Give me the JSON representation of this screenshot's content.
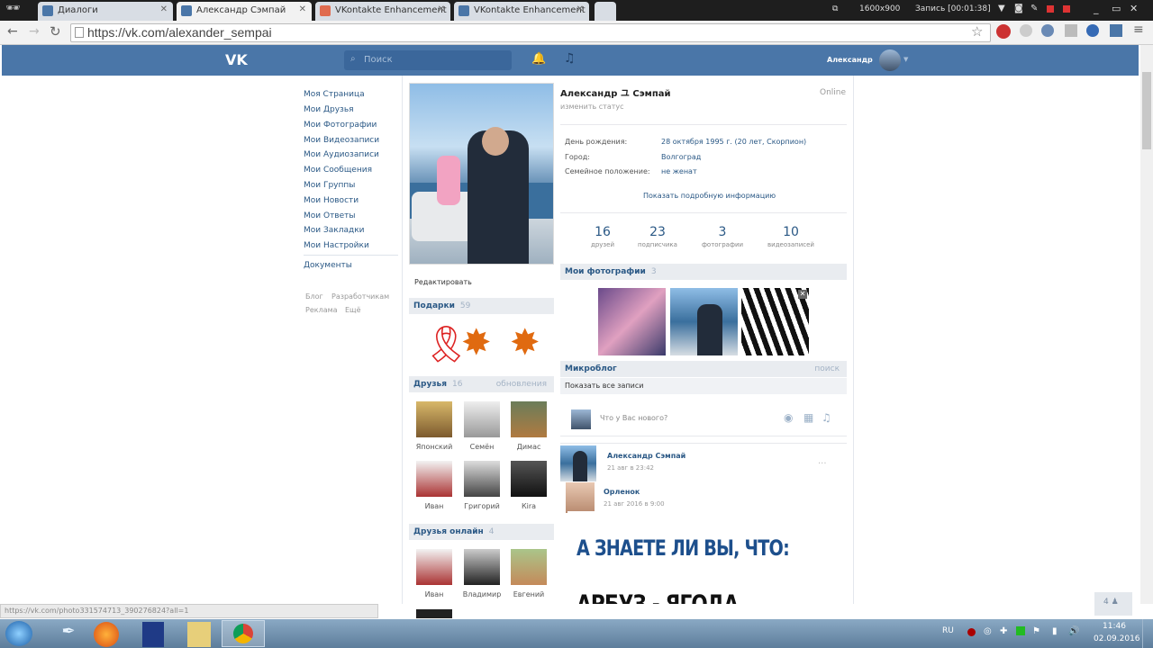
{
  "browser": {
    "tabs": [
      {
        "title": "Диалоги"
      },
      {
        "title": "Александр Сэмпай"
      },
      {
        "title": "VKontakte Enhancement"
      },
      {
        "title": "VKontakte Enhancement"
      }
    ],
    "url": "https://vk.com/alexander_sempai",
    "screen_res": "1600x900",
    "recording": "Запись [00:01:38]",
    "status_url": "https://vk.com/photo331574713_390276824?all=1"
  },
  "vk_header": {
    "logo": "VK",
    "search_placeholder": "Поиск",
    "user_name": "Александр"
  },
  "left_menu": {
    "items": [
      "Моя Страница",
      "Мои Друзья",
      "Мои Фотографии",
      "Мои Видеозаписи",
      "Мои Аудиозаписи",
      "Мои Сообщения",
      "Мои Группы",
      "Мои Новости",
      "Мои Ответы",
      "Мои Закладки",
      "Мои Настройки"
    ],
    "documents": "Документы",
    "footer": [
      "Блог",
      "Разработчикам",
      "Реклама",
      "Ещё"
    ]
  },
  "profile": {
    "name": "Александр ユ Сэмпай",
    "online": "Online",
    "status": "изменить статус",
    "info": [
      {
        "label": "День рождения:",
        "value": "28 октября 1995 г. (20 лет, Скорпион)"
      },
      {
        "label": "Город:",
        "value": "Волгоград"
      },
      {
        "label": "Семейное положение:",
        "value": "не женат"
      }
    ],
    "more_info": "Показать подробную информацию",
    "counters": [
      {
        "n": "16",
        "l": "друзей"
      },
      {
        "n": "23",
        "l": "подписчика"
      },
      {
        "n": "3",
        "l": "фотографии"
      },
      {
        "n": "10",
        "l": "видеозаписей"
      }
    ],
    "edit": "Редактировать"
  },
  "gifts": {
    "title": "Подарки",
    "count": "59"
  },
  "friends": {
    "title": "Друзья",
    "count": "16",
    "updates": "обновления",
    "list": [
      "Японский",
      "Семён",
      "Димас",
      "Иван",
      "Григорий",
      "Кira"
    ]
  },
  "online_friends": {
    "title": "Друзья онлайн",
    "count": "4",
    "list": [
      "Иван",
      "Владимир",
      "Евгений"
    ]
  },
  "photos": {
    "title": "Мои фотографии",
    "count": "3"
  },
  "microblog": {
    "title": "Микроблог",
    "search": "поиск",
    "all_posts": "Показать все записи",
    "composer_placeholder": "Что у Вас нового?"
  },
  "post": {
    "author": "Александр Сэмпай",
    "date": "21 авг в 23:42",
    "repost_author": "Орленок",
    "repost_date": "21 авг 2016 в 9:00",
    "headline1": "А ЗНАЕТЕ ЛИ ВЫ, ЧТО:",
    "headline2": "АРБУЗ - ЯГОДА"
  },
  "taskbar": {
    "lang": "RU",
    "time": "11:46",
    "date": "02.09.2016"
  },
  "colors": {
    "vk_blue": "#4a76a8",
    "link": "#2a5885",
    "block_bg": "#e9ecf0",
    "headline": "#1d4f8c"
  }
}
